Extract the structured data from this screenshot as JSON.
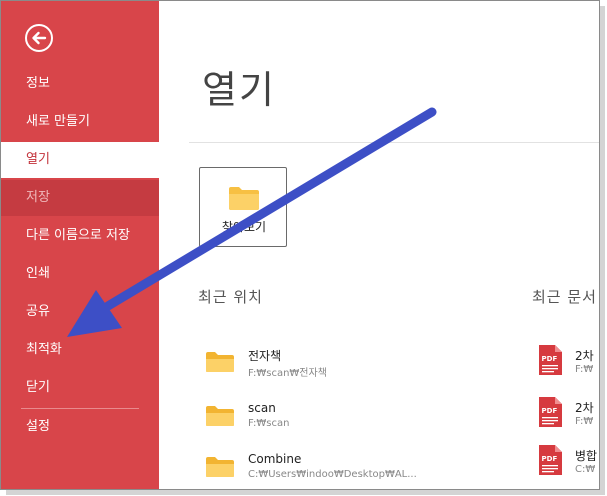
{
  "sidebar": {
    "back_icon": "arrow-left-circle-icon",
    "items": [
      {
        "label": "정보"
      },
      {
        "label": "새로 만들기"
      },
      {
        "label": "열기"
      },
      {
        "label": "저장"
      },
      {
        "label": "다른 이름으로 저장"
      },
      {
        "label": "인쇄"
      },
      {
        "label": "공유"
      },
      {
        "label": "최적화"
      },
      {
        "label": "닫기"
      },
      {
        "label": "설정"
      }
    ],
    "active_item": "열기"
  },
  "main": {
    "title": "열기",
    "browse": {
      "label": "찾아보기",
      "icon": "folder-icon"
    },
    "recent_locations_heading": "최근 위치",
    "recent_docs_heading": "최근 문서",
    "recent_locations": [
      {
        "name": "전자책",
        "path": "F:₩scan₩전자책"
      },
      {
        "name": "scan",
        "path": "F:₩scan"
      },
      {
        "name": "Combine",
        "path": "C:₩Users₩indoo₩Desktop₩AL..."
      }
    ],
    "recent_docs": [
      {
        "name": "2차",
        "path": "F:₩"
      },
      {
        "name": "2차",
        "path": "F:₩"
      },
      {
        "name": "병합",
        "path": "C:₩"
      }
    ]
  },
  "colors": {
    "sidebar_bg": "#d8454a",
    "active_text": "#c3323a",
    "folder_yellow": "#f7c043",
    "pdf_red": "#d63a3f",
    "annotation_arrow": "#3d4fc6"
  },
  "annotation": {
    "type": "arrow",
    "icon": "annotation-arrow-icon"
  }
}
